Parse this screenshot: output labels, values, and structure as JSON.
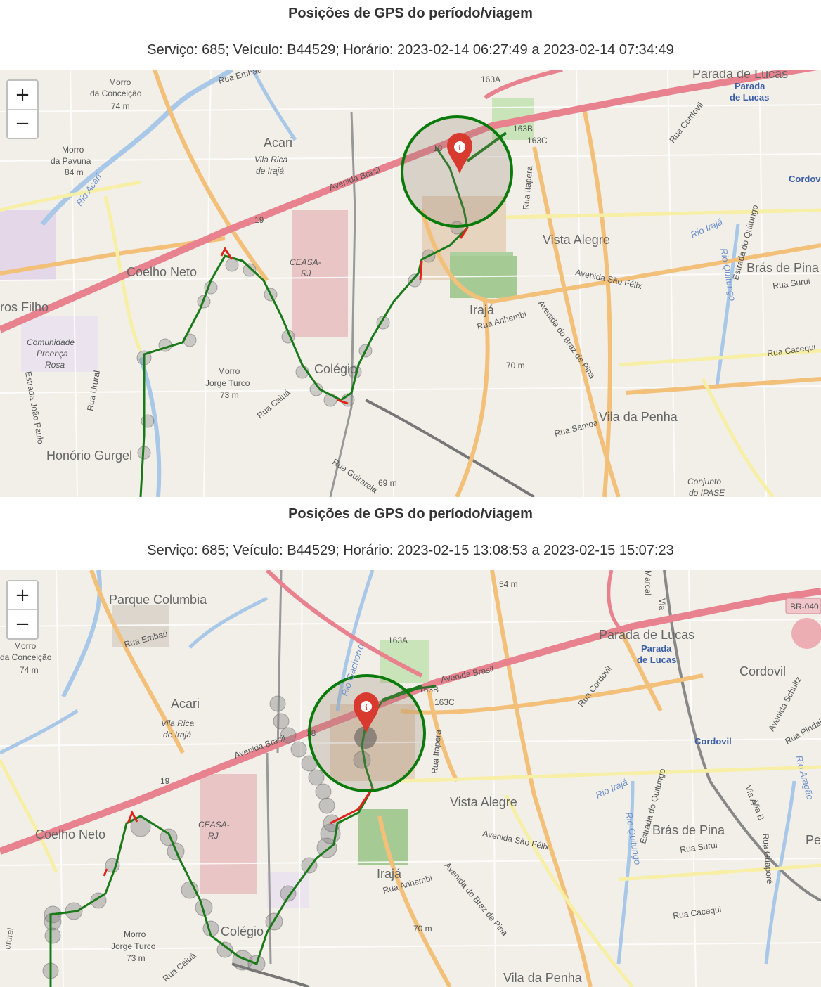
{
  "panels": [
    {
      "title": "Posições de GPS do período/viagem",
      "subtitle": "Serviço: 685; Veículo: B44529; Horário: 2023-02-14 06:27:49 a 2023-02-14 07:34:49",
      "zoom_in": "+",
      "zoom_out": "−",
      "labels": {
        "parada_lucas": "Parada de Lucas",
        "parada": "Parada",
        "de_lucas": "de Lucas",
        "acari": "Acari",
        "vila_rica": "Vila Rica",
        "de_iraja": "de Irajá",
        "morro_conceicao": "Morro",
        "da_conceicao": "da Conceição",
        "m74": "74 m",
        "morro_pavuna": "Morro",
        "da_pavuna": "da Pavuna",
        "m84": "84 m",
        "rio_acari": "Rio Acari",
        "av_brasil": "Avenida Brasil",
        "coelho_neto": "Coelho Neto",
        "ceasa": "CEASA-",
        "rj": "RJ",
        "vista_alegre": "Vista Alegre",
        "iraja": "Irajá",
        "rua_anhembi": "Rua Anhembi",
        "av_sao_felix": "Avenida São Félix",
        "braz_pina": "Avenida do Braz de Pina",
        "m70": "70 m",
        "colegio": "Colégio",
        "morro_jt": "Morro",
        "jorge_turco": "Jorge Turco",
        "m73": "73 m",
        "rua_caiua": "Rua Caiuá",
        "honorio": "Honório Gurgel",
        "vila_penha": "Vila da Penha",
        "rua_samoa": "Rua Samoa",
        "rua_guirareia": "Rua Guirareia",
        "m69": "69 m",
        "rio_iraja": "Rio Irajá",
        "bras_pina": "Brás de Pina",
        "rua_surui": "Rua Surui",
        "rua_cacequi": "Rua Cacequi",
        "conjunto": "Conjunto",
        "do_ipase": "do IPASE",
        "rua_cordovil": "Rua Cordovil",
        "estrada_quitungo": "Estrada do Quitungo",
        "rio_quitungo": "Rio Quitungo",
        "rua_itapera": "Rua Itapera",
        "rua_embau": "Rua Embaú",
        "ros_filho": "ros Filho",
        "comunidade": "Comunidade",
        "proenca": "Proença",
        "rosa": "Rosa",
        "rua_urural": "Rua Urural",
        "estrada_jp": "Estrada João Paulo",
        "cordov": "Cordov",
        "r163a": "163A",
        "r163b": "163B",
        "r163c": "163C",
        "r19": "19",
        "r18": "18"
      }
    },
    {
      "title": "Posições de GPS do período/viagem",
      "subtitle": "Serviço: 685; Veículo: B44529; Horário: 2023-02-15 13:08:53 a 2023-02-15 15:07:23",
      "zoom_in": "+",
      "zoom_out": "−",
      "labels": {
        "parque_colombia": "Parque Columbia",
        "rua_embau": "Rua Embaú",
        "morro": "Morro",
        "da_conceicao": "da Conceição",
        "m74": "74 m",
        "m54": "54 m",
        "acari": "Acari",
        "vila_rica": "Vila Rica",
        "de_iraja": "de Irajá",
        "av_brasil": "Avenida Brasil",
        "av_brasil2": "Avenida Brasil",
        "coelho_neto": "Coelho Neto",
        "ceasa": "CEASA-",
        "rj": "RJ",
        "vista_alegre": "Vista Alegre",
        "iraja": "Irajá",
        "rua_anhembi": "Rua Anhembi",
        "av_sao_felix": "Avenida São Félix",
        "braz_pina": "Avenida do Braz de Pina",
        "m70": "70 m",
        "colegio": "Colégio",
        "morro_jt": "Morro",
        "jorge_turco": "Jorge Turco",
        "m73": "73 m",
        "rua_caiua": "Rua Caiuá",
        "vila_penha": "Vila da Penha",
        "parada_lucas": "Parada de Lucas",
        "parada": "Parada",
        "de_lucas": "de Lucas",
        "cordovil": "Cordovil",
        "cordovil_st": "Cordovil",
        "rio_iraja": "Rio Irajá",
        "bras_pina": "Brás de Pina",
        "rua_surui": "Rua Surui",
        "rua_cacequi": "Rua Cacequi",
        "rua_cordovil": "Rua Cordovil",
        "estrada_quitungo": "Estrada do Quitungo",
        "rio_quitungo": "Rio Quitungo",
        "rua_itapera": "Rua Itapera",
        "rio_gachorro": "Rio Gachorro",
        "br040": "BR-040",
        "av_schultz": "Avenida Schultz",
        "rua_pindai": "Rua Pindai",
        "rio_aragao": "Rio Aragão",
        "rua_guapore": "Rua Guaporé",
        "r163a": "163A",
        "r163b": "163B",
        "r163c": "163C",
        "r19": "19",
        "r18": "18",
        "marcal": "Marcal",
        "via": "Via",
        "via_a": "Via A",
        "via_b": "Via B",
        "pe": "Pe",
        "urural": "urural"
      }
    }
  ],
  "colors": {
    "route_green": "#1a7a1a",
    "route_red": "#e0241b",
    "circle": "#0a7a0a",
    "marker": "#d83a2f",
    "avenue": "#e8828f",
    "primary_road": "#f3c07a",
    "water": "#a9c8e8"
  }
}
